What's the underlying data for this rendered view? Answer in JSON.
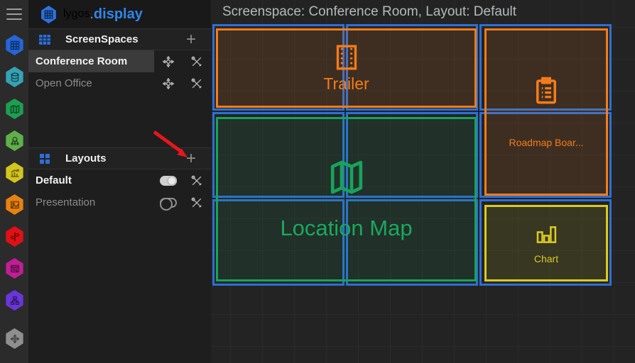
{
  "brand": {
    "name_primary": "lygos",
    "dot": ".",
    "name_secondary": "display"
  },
  "colors": {
    "accent_blue": "#2e6fd4",
    "screen_border_blue": "#2e6fd4",
    "tile_orange": "#f57c1a",
    "tile_green": "#18a35c",
    "tile_yellow": "#d9ca20",
    "annotation_arrow_red": "#e3171d",
    "selected_row_bg": "#3b3b3b",
    "logo_blue": "#3285ec"
  },
  "rail": {
    "icons": [
      {
        "name": "screens-hex-icon",
        "color": "#2566d8"
      },
      {
        "name": "database-hex-icon",
        "color": "#35a3b5"
      },
      {
        "name": "map-hex-icon",
        "color": "#1e9e50"
      },
      {
        "name": "network-hex-icon",
        "color": "#5fb04a"
      },
      {
        "name": "analytics-hex-icon",
        "color": "#d4c41f"
      },
      {
        "name": "media-hex-icon",
        "color": "#e8820f"
      },
      {
        "name": "signpost-hex-icon",
        "color": "#e01115"
      },
      {
        "name": "forms-hex-icon",
        "color": "#c01e96"
      },
      {
        "name": "sitemap-hex-icon",
        "color": "#6a36d9"
      },
      {
        "name": "move-hex-icon",
        "color": "#8f8f8f"
      }
    ]
  },
  "sidebar": {
    "screenspaces": {
      "title": "ScreenSpaces",
      "add_button": "+",
      "items": [
        {
          "label": "Conference Room",
          "selected": true
        },
        {
          "label": "Open Office",
          "selected": false
        }
      ]
    },
    "layouts": {
      "title": "Layouts",
      "add_button": "+",
      "items": [
        {
          "label": "Default",
          "toggle": "on"
        },
        {
          "label": "Presentation",
          "toggle": "off"
        }
      ]
    },
    "annotation_arrow": {
      "points_to": "layouts-add-button",
      "color": "#e3171d"
    }
  },
  "canvas": {
    "header": "Screenspace: Conference Room, Layout: Default",
    "screen_grid": {
      "columns": 3,
      "rows": 3,
      "border_color": "#2e6fd4"
    },
    "tiles": [
      {
        "name": "Trailer",
        "icon": "film-icon",
        "color": "#f57c1a",
        "span": "cols 1-2, row 1"
      },
      {
        "name": "Roadmap Boar...",
        "icon": "clipboard-icon",
        "color": "#f57c1a",
        "span": "col 3, rows 1-2"
      },
      {
        "name": "Location Map",
        "icon": "map-icon",
        "color": "#18a35c",
        "span": "cols 1-2, rows 2-3"
      },
      {
        "name": "Chart",
        "icon": "bar-chart-icon",
        "color": "#d9ca20",
        "span": "col 3, row 3"
      }
    ]
  }
}
